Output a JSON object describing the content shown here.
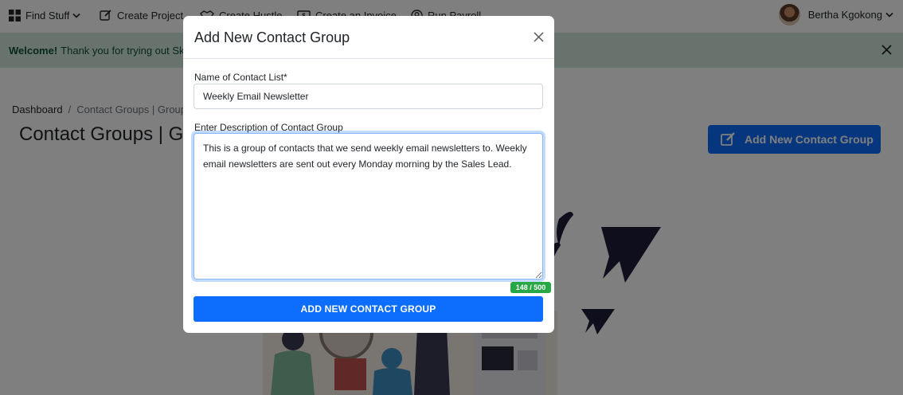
{
  "topnav": {
    "items": [
      {
        "label": "Find Stuff",
        "icon": "grid-icon"
      },
      {
        "label": "Create Project",
        "icon": "edit-icon"
      },
      {
        "label": "Create Hustle",
        "icon": "handshake-icon"
      },
      {
        "label": "Create an Invoice",
        "icon": "invoice-icon"
      },
      {
        "label": "Run Payroll",
        "icon": "payroll-icon"
      }
    ],
    "user_name": "Bertha Kgokong"
  },
  "alert": {
    "strong": "Welcome!",
    "text": "Thank you for trying out Skhok"
  },
  "breadcrumb": {
    "home": "Dashboard",
    "current": "Contact Groups | Group En"
  },
  "page": {
    "title": "Contact Groups | Group",
    "add_button_label": "Add New Contact Group"
  },
  "modal": {
    "title": "Add New Contact Group",
    "name_label": "Name of Contact List*",
    "name_value": "Weekly Email Newsletter",
    "description_label": "Enter Description of Contact Group",
    "description_value": "This is a group of contacts that we send weekly email newsletters to. Weekly email newsletters are sent out every Monday morning by the Sales Lead.",
    "char_counter": "148 / 500",
    "submit_label": "ADD NEW CONTACT GROUP"
  },
  "colors": {
    "primary": "#0d6efd",
    "alert_bg": "#d1e7dd",
    "counter_bg": "#28a745",
    "illustration_dark": "#1f1d3a"
  }
}
